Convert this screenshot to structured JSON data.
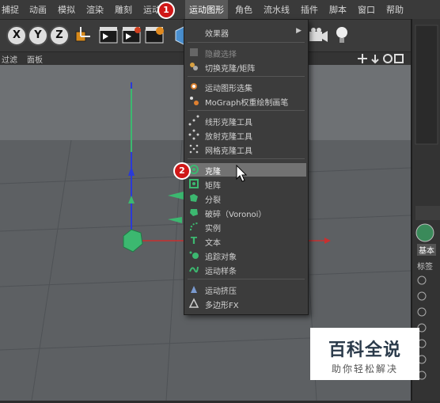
{
  "menubar": {
    "items": [
      "捕捉",
      "动画",
      "模拟",
      "渲染",
      "雕刻",
      "运动",
      "运动图形",
      "角色",
      "流水线",
      "插件",
      "脚本",
      "窗口",
      "帮助"
    ],
    "active_index": 6
  },
  "toolbar": {
    "axis_x": "X",
    "axis_y": "Y",
    "axis_z": "Z"
  },
  "subbar": {
    "left_label": "过滤",
    "panel_label": "面板"
  },
  "dropdown": {
    "items": [
      {
        "label": "效果器",
        "icon": "effector-icon",
        "submenu": true
      },
      {
        "label": "隐藏选择",
        "icon": "hide-selection-icon",
        "disabled": true
      },
      {
        "label": "切换克隆/矩阵",
        "icon": "toggle-clone-icon"
      },
      {
        "label": "运动图形选集",
        "icon": "mograph-selection-icon"
      },
      {
        "label": "MoGraph权重绘制画笔",
        "icon": "weight-brush-icon"
      },
      {
        "label": "线形克隆工具",
        "icon": "linear-clone-icon"
      },
      {
        "label": "放射克隆工具",
        "icon": "radial-clone-icon"
      },
      {
        "label": "网格克隆工具",
        "icon": "grid-clone-icon"
      },
      {
        "label": "克隆",
        "icon": "cloner-icon",
        "highlighted": true
      },
      {
        "label": "矩阵",
        "icon": "matrix-icon"
      },
      {
        "label": "分裂",
        "icon": "fracture-icon"
      },
      {
        "label": "破碎（Voronoi）",
        "icon": "voronoi-icon"
      },
      {
        "label": "实例",
        "icon": "instance-icon"
      },
      {
        "label": "文本",
        "icon": "text-icon"
      },
      {
        "label": "追踪对象",
        "icon": "tracer-icon"
      },
      {
        "label": "运动样条",
        "icon": "mospline-icon"
      },
      {
        "label": "运动挤压",
        "icon": "moextrude-icon"
      },
      {
        "label": "多边形FX",
        "icon": "polyfx-icon"
      }
    ]
  },
  "steps": {
    "step1": "1",
    "step2": "2"
  },
  "right_panel": {
    "tab_basic": "基本",
    "tab_label": "标签"
  },
  "watermark": {
    "title": "百科全说",
    "subtitle": "助你轻松解决"
  },
  "colors": {
    "highlight": "#727272",
    "step_badge": "#d01818",
    "axis_y": "#2a3ad8",
    "axis_x": "#c83030",
    "object": "#3cb870"
  }
}
